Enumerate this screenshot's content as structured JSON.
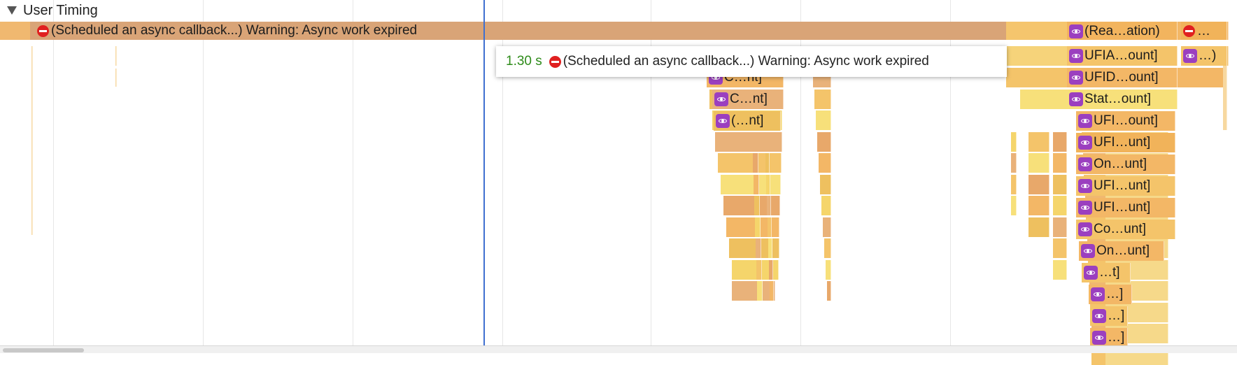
{
  "section": {
    "title": "User Timing",
    "expanded": true
  },
  "long_measure": {
    "label": "(Scheduled an async callback...) Warning: Async work expired",
    "icon": "warning-icon"
  },
  "tooltip": {
    "duration": "1.30 s",
    "label": "(Scheduled an async callback...) Warning: Async work expired",
    "icon": "warning-icon"
  },
  "labels": [
    {
      "text": "(Rea…ation)",
      "icon": "react-icon"
    },
    {
      "text": "…",
      "icon": "warning-icon"
    },
    {
      "text": "UFIA…ount]",
      "icon": "react-icon"
    },
    {
      "text": "…)",
      "icon": "react-icon"
    },
    {
      "text": "UFID…ount]",
      "icon": "react-icon"
    },
    {
      "text": "C…nt]",
      "icon": "react-icon"
    },
    {
      "text": "Stat…ount]",
      "icon": "react-icon"
    },
    {
      "text": "C…nt]",
      "icon": "react-icon"
    },
    {
      "text": "UFI…ount]",
      "icon": "react-icon"
    },
    {
      "text": "(…nt]",
      "icon": "react-icon"
    },
    {
      "text": "UFI…unt]",
      "icon": "react-icon"
    },
    {
      "text": "On…unt]",
      "icon": "react-icon"
    },
    {
      "text": "UFI…unt]",
      "icon": "react-icon"
    },
    {
      "text": "UFI…unt]",
      "icon": "react-icon"
    },
    {
      "text": "Co…unt]",
      "icon": "react-icon"
    },
    {
      "text": "On…unt]",
      "icon": "react-icon"
    },
    {
      "text": "…t]",
      "icon": "react-icon"
    },
    {
      "text": "…]",
      "icon": "react-icon"
    },
    {
      "text": "…]",
      "icon": "react-icon"
    },
    {
      "text": "…]",
      "icon": "react-icon"
    }
  ],
  "colors": {
    "measure": "#d9a477",
    "react": "#9b3fbf",
    "warning": "#e02020",
    "duration": "#2e8b1a",
    "cursor": "#3f6fd0"
  }
}
